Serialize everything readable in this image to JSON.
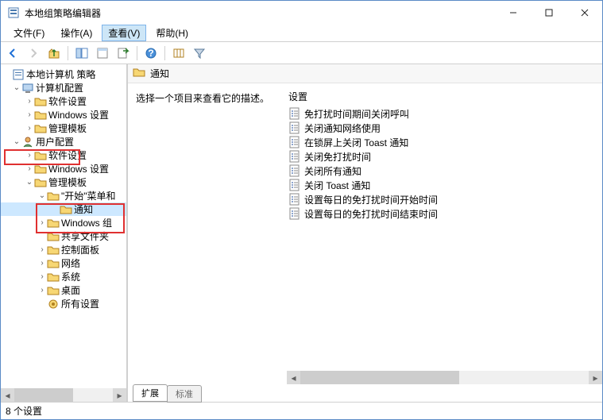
{
  "window": {
    "title": "本地组策略编辑器"
  },
  "menu": {
    "file": "文件(F)",
    "action": "操作(A)",
    "view": "查看(V)",
    "help": "帮助(H)"
  },
  "tree": {
    "root": "本地计算机 策略",
    "computer_cfg": "计算机配置",
    "cc_software": "软件设置",
    "cc_windows": "Windows 设置",
    "cc_admin": "管理模板",
    "user_cfg": "用户配置",
    "uc_software": "软件设置",
    "uc_windows": "Windows 设置",
    "uc_admin": "管理模板",
    "start_menu": "\"开始\"菜单和",
    "notifications": "通知",
    "windows_comp": "Windows 组",
    "shared_folders": "共享文件夹",
    "control_panel": "控制面板",
    "network": "网络",
    "system": "系统",
    "desktop": "桌面",
    "all_settings": "所有设置"
  },
  "content": {
    "header": "通知",
    "description": "选择一个项目来查看它的描述。",
    "column_header": "设置",
    "items": [
      "免打扰时间期间关闭呼叫",
      "关闭通知网络使用",
      "在锁屏上关闭 Toast 通知",
      "关闭免打扰时间",
      "关闭所有通知",
      "关闭 Toast 通知",
      "设置每日的免打扰时间开始时间",
      "设置每日的免打扰时间结束时间"
    ],
    "tabs": {
      "extended": "扩展",
      "standard": "标准"
    }
  },
  "status": "8 个设置"
}
